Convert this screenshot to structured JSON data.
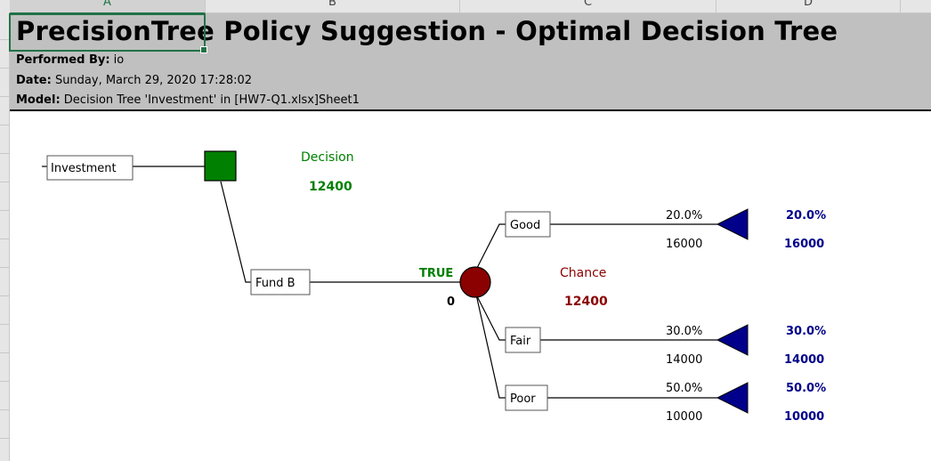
{
  "columns": [
    "A",
    "B",
    "C",
    "D"
  ],
  "report": {
    "title": "PrecisionTree Policy Suggestion - Optimal Decision Tree",
    "performed_by_label": "Performed By:",
    "performed_by_value": "io",
    "date_label": "Date:",
    "date_value": "Sunday, March 29, 2020 17:28:02",
    "model_label": "Model:",
    "model_value": "Decision Tree 'Investment' in [HW7-Q1.xlsx]Sheet1"
  },
  "tree": {
    "root": {
      "label": "Investment"
    },
    "decision": {
      "label": "Decision",
      "value": "12400",
      "color": "#008000"
    },
    "branch": {
      "label": "Fund B",
      "flag": "TRUE",
      "cost": "0"
    },
    "chance": {
      "label": "Chance",
      "value": "12400",
      "color": "#8b0000"
    },
    "outcomes": [
      {
        "label": "Good",
        "prob": "20.0%",
        "payoff": "16000",
        "end_prob": "20.0%",
        "end_payoff": "16000"
      },
      {
        "label": "Fair",
        "prob": "30.0%",
        "payoff": "14000",
        "end_prob": "30.0%",
        "end_payoff": "14000"
      },
      {
        "label": "Poor",
        "prob": "50.0%",
        "payoff": "10000",
        "end_prob": "50.0%",
        "end_payoff": "10000"
      }
    ],
    "end_color": "#00008b"
  }
}
